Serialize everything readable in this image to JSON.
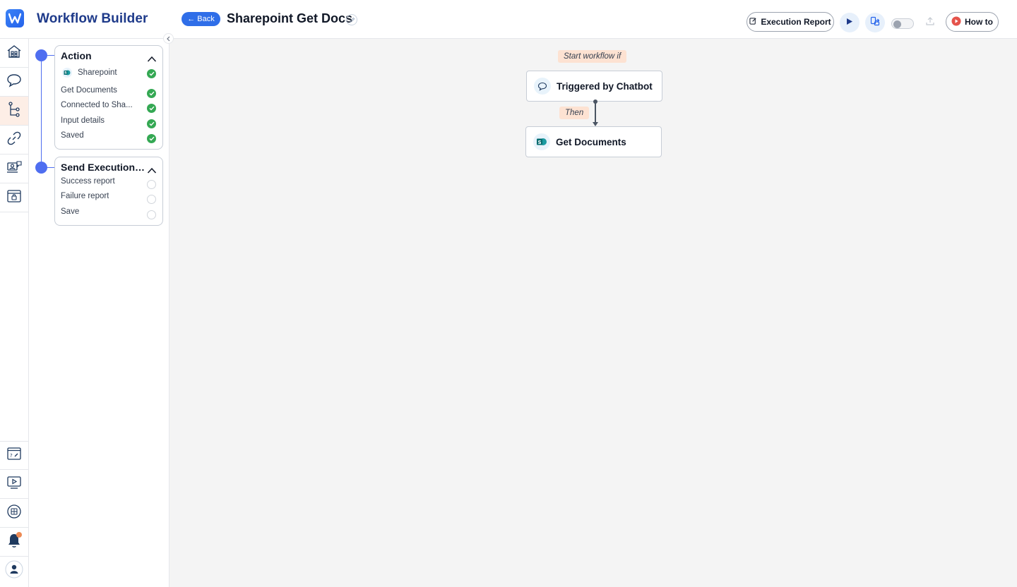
{
  "header": {
    "app_title": "Workflow Builder",
    "back_label": "← Back",
    "workflow_name": "Sharepoint Get Docs",
    "execution_report_label": "Execution Report",
    "how_to_label": "How to",
    "workflow_active": false
  },
  "rail": {
    "top_items": [
      "home-icon",
      "chat-icon",
      "workflow-icon",
      "link-icon",
      "agent-icon",
      "store-icon"
    ],
    "bottom_items": [
      "help-icon",
      "video-icon",
      "docs-icon",
      "bell-icon",
      "user-icon"
    ],
    "active_item": "workflow-icon"
  },
  "steps": {
    "action": {
      "title": "Action",
      "integration": "Sharepoint",
      "items": [
        "Get Documents",
        "Connected to Sha...",
        "Input details",
        "Saved"
      ]
    },
    "send_report": {
      "title": "Send Execution R...",
      "items": [
        "Success report",
        "Failure report",
        "Save"
      ]
    }
  },
  "canvas": {
    "start_tag": "Start workflow if",
    "trigger_node": "Triggered by Chatbot",
    "then_tag": "Then",
    "action_node": "Get Documents"
  },
  "colors": {
    "brand": "#2f6ee8",
    "timeline": "#4f6ef0",
    "success": "#34a853",
    "tag_bg": "#fde2d2",
    "active_rail": "#fdeee6"
  }
}
